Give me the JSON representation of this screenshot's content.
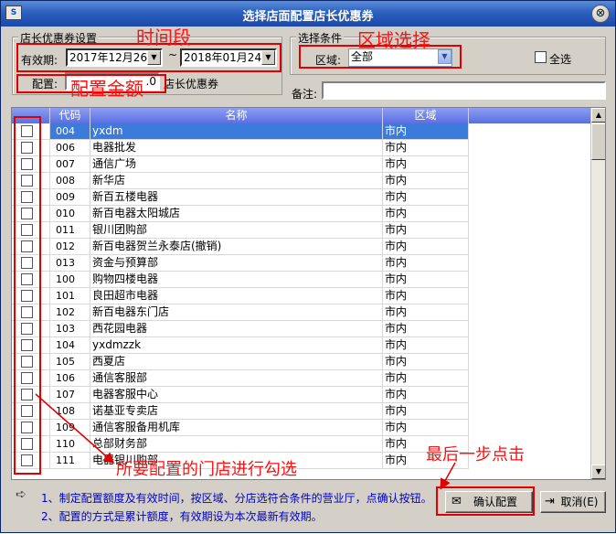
{
  "window": {
    "title": "选择店面配置店长优惠券",
    "app_icon": "app-icon",
    "close_glyph": "⊗"
  },
  "coupon_group": {
    "legend": "店长优惠券设置",
    "validity_label": "有效期:",
    "date_from": "2017年12月26日",
    "date_sep": "~",
    "date_to": "2018年01月24日",
    "amount_label": "配置:",
    "amount_value": ".0",
    "amount_suffix": "店长优惠券"
  },
  "filter_group": {
    "legend": "选择条件",
    "region_label": "区域:",
    "region_value": "全部",
    "select_all_label": "全选"
  },
  "remark": {
    "label": "备注:",
    "value": ""
  },
  "table": {
    "columns": [
      "代码",
      "名称",
      "区域"
    ],
    "rows": [
      {
        "code": "004",
        "name": "yxdm",
        "area": "市内",
        "selected": true
      },
      {
        "code": "006",
        "name": "电器批发",
        "area": "市内"
      },
      {
        "code": "007",
        "name": "通信广场",
        "area": "市内"
      },
      {
        "code": "008",
        "name": "新华店",
        "area": "市内"
      },
      {
        "code": "009",
        "name": "新百五楼电器",
        "area": "市内"
      },
      {
        "code": "010",
        "name": "新百电器太阳城店",
        "area": "市内"
      },
      {
        "code": "011",
        "name": "银川团购部",
        "area": "市内"
      },
      {
        "code": "012",
        "name": "新百电器贺兰永泰店(撤销)",
        "area": "市内"
      },
      {
        "code": "013",
        "name": "资金与预算部",
        "area": "市内"
      },
      {
        "code": "100",
        "name": "购物四楼电器",
        "area": "市内"
      },
      {
        "code": "101",
        "name": "良田超市电器",
        "area": "市内"
      },
      {
        "code": "102",
        "name": "新百电器东门店",
        "area": "市内"
      },
      {
        "code": "103",
        "name": "西花园电器",
        "area": "市内"
      },
      {
        "code": "104",
        "name": "yxdmzzk",
        "area": "市内"
      },
      {
        "code": "105",
        "name": "西夏店",
        "area": "市内"
      },
      {
        "code": "106",
        "name": "通信客服部",
        "area": "市内"
      },
      {
        "code": "107",
        "name": "电器客服中心",
        "area": "市内"
      },
      {
        "code": "108",
        "name": "诺基亚专卖店",
        "area": "市内"
      },
      {
        "code": "109",
        "name": "通信客服备用机库",
        "area": "市内"
      },
      {
        "code": "110",
        "name": "总部财务部",
        "area": "市内"
      },
      {
        "code": "111",
        "name": "电器银川购部",
        "area": "市内"
      }
    ]
  },
  "hints": {
    "line1": "1、制定配置额度及有效时间，按区域、分店选符合条件的营业厅，点确认按钮。",
    "line2": "2、配置的方式是累计额度，有效期设为本次最新有效期。"
  },
  "buttons": {
    "confirm": "确认配置",
    "cancel": "取消(E)"
  },
  "annotations": {
    "time_period": "时间段",
    "region_select": "区域选择",
    "config_amount": "配置金额",
    "check_stores": "所要配置的门店进行勾选",
    "final_click": "最后一步点击"
  },
  "colors": {
    "annotation_red": "#e00000",
    "selected_row": "#3a7bdc",
    "hint_blue": "#0000c8"
  }
}
